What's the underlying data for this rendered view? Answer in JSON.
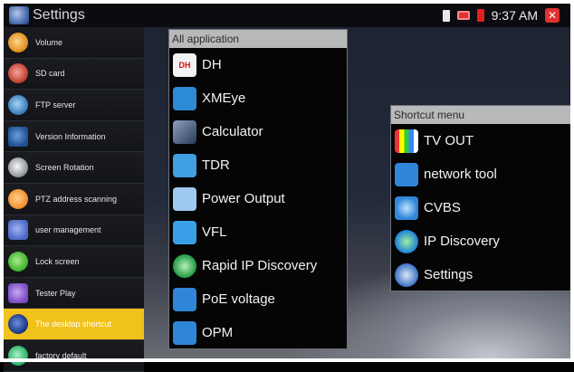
{
  "status_bar": {
    "title": "Settings",
    "time": "9:37 AM"
  },
  "sidebar": {
    "items": [
      {
        "label": "Volume",
        "icon": "volume-icon"
      },
      {
        "label": "SD card",
        "icon": "sd-card-icon"
      },
      {
        "label": "FTP server",
        "icon": "ftp-server-icon"
      },
      {
        "label": "Version Information",
        "icon": "version-info-icon"
      },
      {
        "label": "Screen Rotation",
        "icon": "screen-rotation-icon"
      },
      {
        "label": "PTZ address scanning",
        "icon": "ptz-scan-icon"
      },
      {
        "label": "user management",
        "icon": "user-management-icon"
      },
      {
        "label": "Lock screen",
        "icon": "lock-icon"
      },
      {
        "label": "Tester Play",
        "icon": "tester-play-icon"
      },
      {
        "label": "The desktop shortcut",
        "icon": "desktop-shortcut-icon",
        "selected": true
      },
      {
        "label": "factory default",
        "icon": "factory-default-icon"
      }
    ],
    "selected_color": "#f1c21c"
  },
  "all_application": {
    "title": "All application",
    "apps": [
      {
        "label": "DH",
        "icon": "dh-app-icon"
      },
      {
        "label": "XMEye",
        "icon": "xmeye-app-icon"
      },
      {
        "label": "Calculator",
        "icon": "calculator-app-icon"
      },
      {
        "label": "TDR",
        "icon": "tdr-app-icon"
      },
      {
        "label": "Power Output",
        "icon": "power-output-app-icon"
      },
      {
        "label": "VFL",
        "icon": "vfl-app-icon"
      },
      {
        "label": "Rapid IP Discovery",
        "icon": "rapid-ip-discovery-app-icon"
      },
      {
        "label": "PoE voltage",
        "icon": "poe-voltage-app-icon"
      },
      {
        "label": "OPM",
        "icon": "opm-app-icon"
      }
    ]
  },
  "shortcut_menu": {
    "title": "Shortcut menu",
    "items": [
      {
        "label": "TV OUT",
        "icon": "tv-out-icon"
      },
      {
        "label": "network tool",
        "icon": "network-tool-icon"
      },
      {
        "label": "CVBS",
        "icon": "cvbs-icon"
      },
      {
        "label": "IP Discovery",
        "icon": "ip-discovery-icon"
      },
      {
        "label": "Settings",
        "icon": "settings-icon"
      }
    ]
  }
}
